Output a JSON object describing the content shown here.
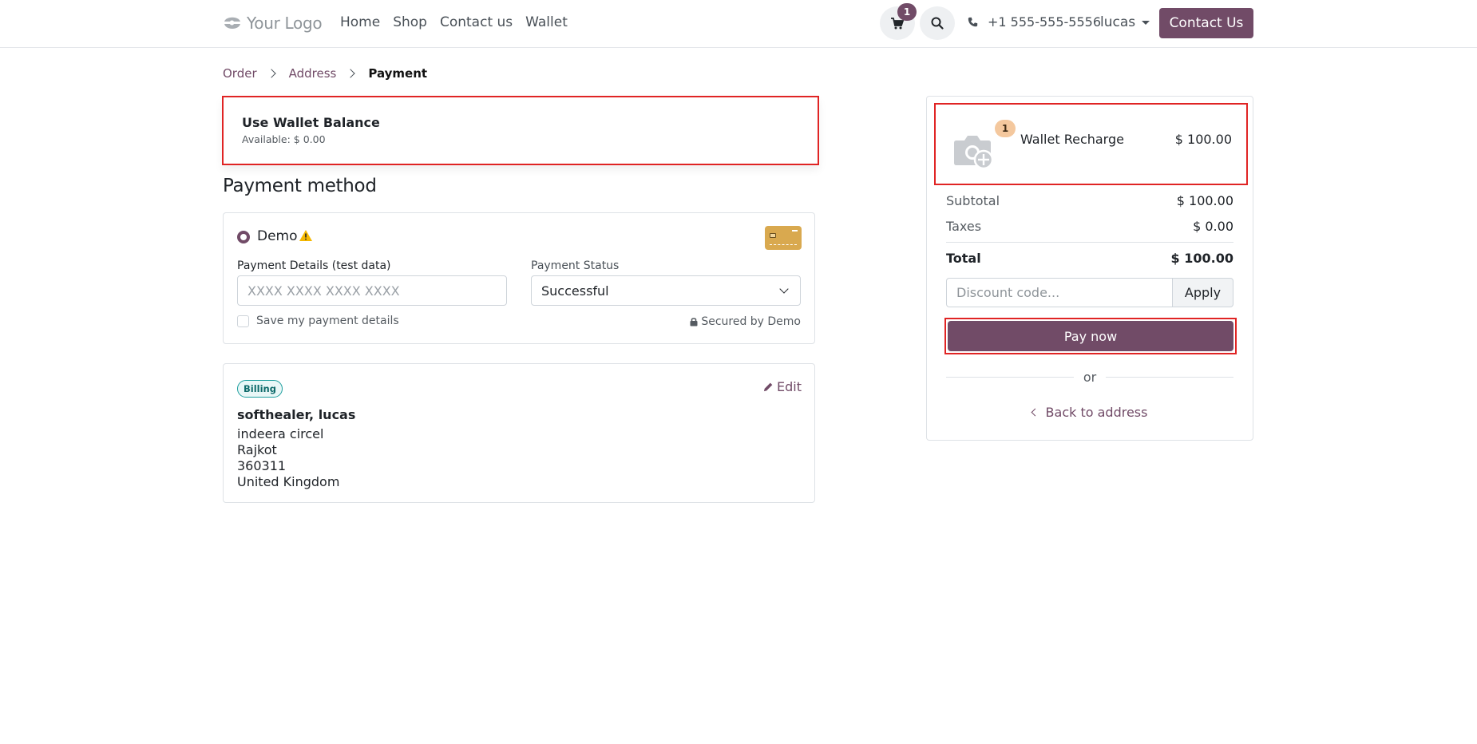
{
  "header": {
    "logo_text": "Your Logo",
    "nav": [
      "Home",
      "Shop",
      "Contact us",
      "Wallet"
    ],
    "cart_count": "1",
    "phone": "+1 555-555-5556",
    "user": "lucas",
    "contact_button": "Contact Us"
  },
  "breadcrumb": {
    "order": "Order",
    "address": "Address",
    "payment": "Payment"
  },
  "wallet": {
    "title": "Use Wallet Balance",
    "available": "Available: $ 0.00"
  },
  "payment_method": {
    "title": "Payment method",
    "provider": "Demo",
    "details_label": "Payment Details (test data)",
    "details_placeholder": "XXXX XXXX XXXX XXXX",
    "status_label": "Payment Status",
    "status_value": "Successful",
    "save_label": "Save my payment details",
    "secured": "Secured by Demo"
  },
  "billing": {
    "badge": "Billing",
    "edit": "Edit",
    "name": "softhealer, lucas",
    "lines": [
      "indeera circel",
      "Rajkot",
      "360311",
      "United Kingdom"
    ]
  },
  "summary": {
    "item_qty": "1",
    "item_name": "Wallet Recharge",
    "item_price": "$ 100.00",
    "subtotal_label": "Subtotal",
    "subtotal": "$ 100.00",
    "taxes_label": "Taxes",
    "taxes": "$ 0.00",
    "total_label": "Total",
    "total": "$ 100.00",
    "discount_placeholder": "Discount code...",
    "apply": "Apply",
    "pay_now": "Pay now",
    "or": "or",
    "back": "Back to address"
  },
  "colors": {
    "brand": "#714b67",
    "highlight": "#e02424",
    "warning": "#f5b800"
  }
}
